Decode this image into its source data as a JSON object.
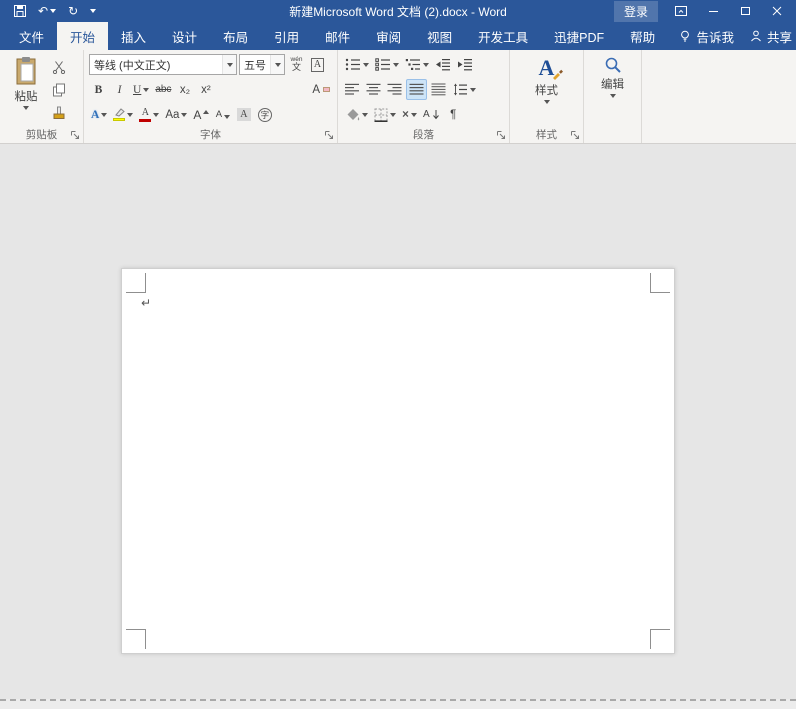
{
  "titlebar": {
    "title": "新建Microsoft Word 文档 (2).docx - Word",
    "login_label": "登录"
  },
  "icons": {
    "undo_glyph": "↶",
    "redo_glyph": "↻"
  },
  "tabs": {
    "file": "文件",
    "home": "开始",
    "insert": "插入",
    "design": "设计",
    "layout": "布局",
    "references": "引用",
    "mailings": "邮件",
    "review": "审阅",
    "view": "视图",
    "developer": "开发工具",
    "pdf": "迅捷PDF",
    "help": "帮助",
    "tellme": "告诉我",
    "share": "共享"
  },
  "ribbon": {
    "clipboard": {
      "group_label": "剪贴板",
      "paste_label": "粘贴"
    },
    "font": {
      "group_label": "字体",
      "font_name_value": "等线 (中文正文)",
      "font_size_value": "五号",
      "glyphs": {
        "bold": "B",
        "italic": "I",
        "underline": "U",
        "strikethrough": "abc",
        "subscript": "x₂",
        "superscript": "x²",
        "clear_formatting": "A",
        "text_effects": "A",
        "font_color": "A",
        "change_case": "Aa",
        "grow_font": "A",
        "shrink_font": "A",
        "char_shading": "A",
        "enclose_char": "字",
        "pinyin_top": "wén",
        "pinyin_bottom": "文",
        "char_border": "A"
      }
    },
    "paragraph": {
      "group_label": "段落",
      "asian_layout_glyph": "×",
      "sort_glyph": "A",
      "show_hide_glyph": "¶"
    },
    "styles": {
      "group_label": "样式",
      "button_label": "样式",
      "icon_glyph": "A"
    },
    "editing": {
      "button_label": "编辑"
    }
  },
  "document": {
    "paragraph_mark": "↵"
  },
  "colors": {
    "titlebar_blue": "#2b579a",
    "selected_tab_text": "#2b579a",
    "ribbon_bg": "#f5f4f2",
    "canvas_bg": "#e6e6e6",
    "page_bg": "#ffffff",
    "highlight_yellow": "#ffff00",
    "font_color_red": "#c00000"
  }
}
